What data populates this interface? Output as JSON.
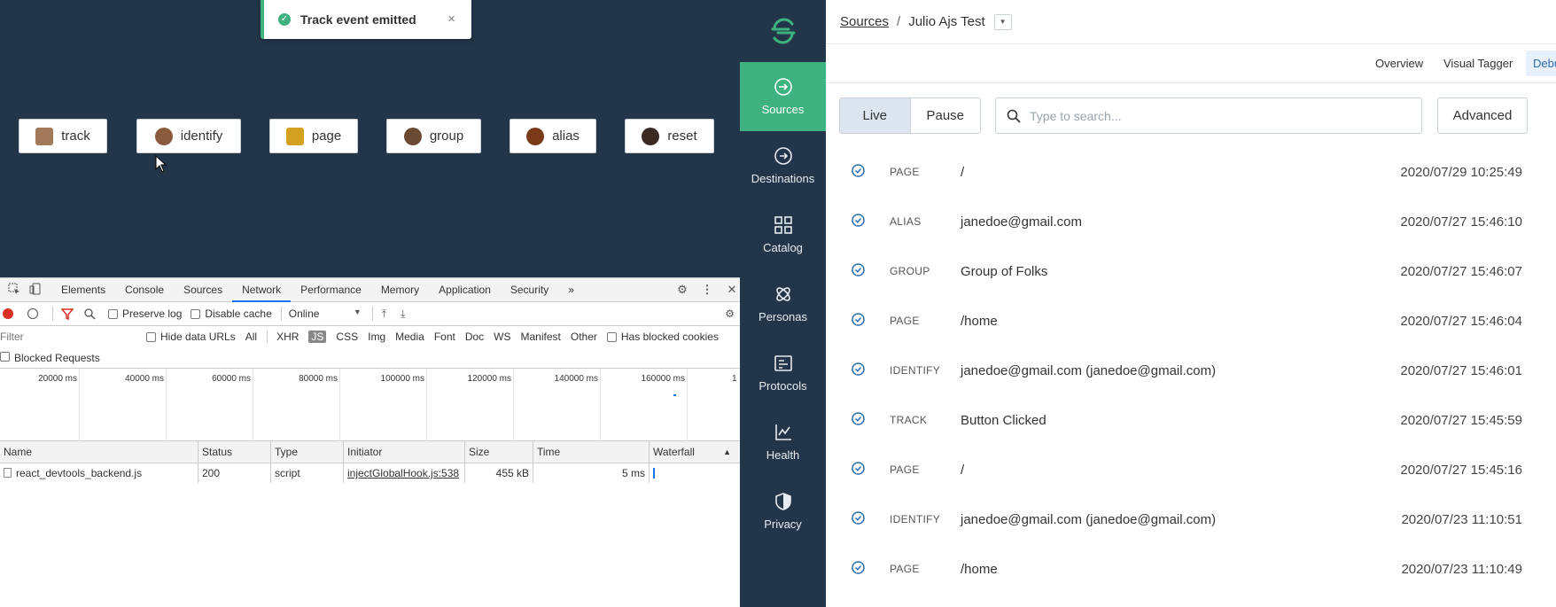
{
  "toast": {
    "message": "Track event emitted",
    "close": "×"
  },
  "app_buttons": [
    {
      "label": "track",
      "color": "#a0785a"
    },
    {
      "label": "identify",
      "color": "#8a5a3c"
    },
    {
      "label": "page",
      "color": "#d4a020"
    },
    {
      "label": "group",
      "color": "#6a4a34"
    },
    {
      "label": "alias",
      "color": "#7a3a1a"
    },
    {
      "label": "reset",
      "color": "#3a2a22"
    }
  ],
  "devtools": {
    "tabs": [
      "Elements",
      "Console",
      "Sources",
      "Network",
      "Performance",
      "Memory",
      "Application",
      "Security"
    ],
    "active_tab": "Network",
    "more": "»",
    "toolbar": {
      "preserve_log": "Preserve log",
      "disable_cache": "Disable cache",
      "throttle": "Online"
    },
    "filter_placeholder": "Filter",
    "hide_data_urls": "Hide data URLs",
    "filter_types": [
      "All",
      "XHR",
      "JS",
      "CSS",
      "Img",
      "Media",
      "Font",
      "Doc",
      "WS",
      "Manifest",
      "Other"
    ],
    "active_filter": "JS",
    "has_blocked_cookies": "Has blocked cookies",
    "blocked_requests": "Blocked Requests",
    "timeline_ticks": [
      "20000 ms",
      "40000 ms",
      "60000 ms",
      "80000 ms",
      "100000 ms",
      "120000 ms",
      "140000 ms",
      "160000 ms",
      "1"
    ],
    "columns": [
      "Name",
      "Status",
      "Type",
      "Initiator",
      "Size",
      "Time",
      "Waterfall"
    ],
    "rows": [
      {
        "name": "react_devtools_backend.js",
        "status": "200",
        "type": "script",
        "initiator": "injectGlobalHook.js:538",
        "size": "455 kB",
        "time": "5 ms"
      }
    ]
  },
  "nav": {
    "items": [
      {
        "label": "Sources",
        "icon": "sources-icon"
      },
      {
        "label": "Destinations",
        "icon": "destinations-icon"
      },
      {
        "label": "Catalog",
        "icon": "catalog-icon"
      },
      {
        "label": "Personas",
        "icon": "personas-icon"
      },
      {
        "label": "Protocols",
        "icon": "protocols-icon"
      },
      {
        "label": "Health",
        "icon": "health-icon"
      },
      {
        "label": "Privacy",
        "icon": "privacy-icon"
      }
    ],
    "active": "Sources",
    "accent": "#3fb37f"
  },
  "breadcrumb": {
    "root": "Sources",
    "separator": "/",
    "current": "Julio Ajs Test"
  },
  "subtabs": [
    "Overview",
    "Visual Tagger",
    "Debu"
  ],
  "controls": {
    "live": "Live",
    "pause": "Pause",
    "search_placeholder": "Type to search...",
    "advanced": "Advanced"
  },
  "events": [
    {
      "type": "PAGE",
      "name": "/",
      "time": "2020/07/29 10:25:49"
    },
    {
      "type": "ALIAS",
      "name": "janedoe@gmail.com",
      "time": "2020/07/27 15:46:10"
    },
    {
      "type": "GROUP",
      "name": "Group of Folks",
      "time": "2020/07/27 15:46:07"
    },
    {
      "type": "PAGE",
      "name": "/home",
      "time": "2020/07/27 15:46:04"
    },
    {
      "type": "IDENTIFY",
      "name": "janedoe@gmail.com (janedoe@gmail.com)",
      "time": "2020/07/27 15:46:01"
    },
    {
      "type": "TRACK",
      "name": "Button Clicked",
      "time": "2020/07/27 15:45:59"
    },
    {
      "type": "PAGE",
      "name": "/",
      "time": "2020/07/27 15:45:16"
    },
    {
      "type": "IDENTIFY",
      "name": "janedoe@gmail.com (janedoe@gmail.com)",
      "time": "2020/07/23 11:10:51"
    },
    {
      "type": "PAGE",
      "name": "/home",
      "time": "2020/07/23 11:10:49"
    }
  ]
}
